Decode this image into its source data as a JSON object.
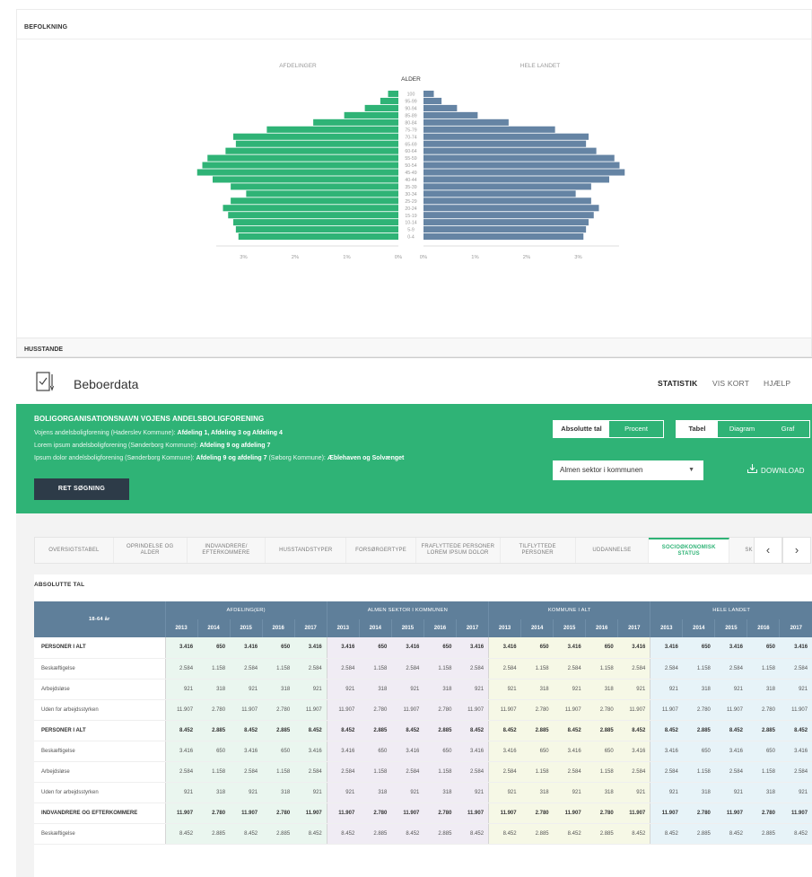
{
  "population": {
    "title": "BEFOLKNING",
    "left_label": "AFDELINGER",
    "right_label": "HELE LANDET",
    "center_label": "ALDER",
    "x_ticks_left": [
      "3%",
      "2%",
      "1%",
      "0%"
    ],
    "x_ticks_right": [
      "0%",
      "1%",
      "2%",
      "3%"
    ],
    "left_color": "#2fb376",
    "right_color": "#6584a4"
  },
  "chart_data": {
    "type": "bar",
    "orientation": "horizontal-pyramid",
    "categories": [
      "100",
      "95-99",
      "90-94",
      "85-89",
      "80-84",
      "75-79",
      "70-74",
      "65-69",
      "60-64",
      "55-59",
      "50-54",
      "45-49",
      "40-44",
      "35-39",
      "30-34",
      "25-29",
      "20-24",
      "15-19",
      "10-14",
      "5-9",
      "0-4"
    ],
    "series": [
      {
        "name": "AFDELINGER",
        "values": [
          0.2,
          0.35,
          0.65,
          1.05,
          1.65,
          2.55,
          3.2,
          3.15,
          3.35,
          3.7,
          3.8,
          3.9,
          3.6,
          3.25,
          2.95,
          3.25,
          3.4,
          3.3,
          3.2,
          3.15,
          3.1
        ]
      },
      {
        "name": "HELE LANDET",
        "values": [
          0.2,
          0.35,
          0.65,
          1.05,
          1.65,
          2.55,
          3.2,
          3.15,
          3.35,
          3.7,
          3.8,
          3.9,
          3.6,
          3.25,
          2.95,
          3.25,
          3.4,
          3.3,
          3.2,
          3.15,
          3.1
        ]
      }
    ],
    "xlim": [
      0,
      4
    ],
    "xlabel": "",
    "ylabel": "ALDER"
  },
  "husstande": {
    "title": "HUSSTANDE"
  },
  "app": {
    "title": "Beboerdata",
    "nav": [
      "STATISTIK",
      "VIS KORT",
      "HJÆLP"
    ]
  },
  "search": {
    "org_name": "BOLIGORGANISATIONSNAVN VOJENS ANDELSBOLIGFORENING",
    "line1_plain": "Vojens andelsboligforening  (Haderslev Kommune): ",
    "line1_bold": "Afdeling 1,  Afdeling 3 og Afdeling 4",
    "line2_plain": "Lorem ipsum andelsboligforening (Sønderborg Kommune): ",
    "line2_bold": "Afdeling 9 og afdeling 7",
    "line3_plain": "Ipsum dolor andelsboligforening (Sønderborg Kommune): ",
    "line3_bold": "Afdeling 9 og afdeling 7",
    "line3_plain2": " (Søborg Kommune): ",
    "line3_bold2": "Æblehaven og  Solvænget",
    "ret_button": "RET SØGNING",
    "toggle_values": [
      "Absolutte tal",
      "Procent"
    ],
    "toggle_view": [
      "Tabel",
      "Diagram",
      "Graf"
    ],
    "sector_select": "Almen sektor i kommunen",
    "download": "DOWNLOAD"
  },
  "tabs": [
    "OVERSIGTSTABEL",
    "OPRINDELSE OG ALDER",
    "INDVANDRERE/ EFTERKOMMERE",
    "HUSSTANDSTYPER",
    "FORSØRGERTYPE",
    "FRAFLYTTEDE PERSONER LOREM IPSUM DOLOR",
    "TILFLYTTEDE PERSONER",
    "UDDANNELSE",
    "SOCIOØKONOMISK STATUS",
    "SK"
  ],
  "table": {
    "section_title": "ABSOLUTTE TAL",
    "age_header": "18-64 år",
    "groups": [
      "AFDELING(ER)",
      "ALMEN SEKTOR I KOMMUNEN",
      "KOMMUNE I ALT",
      "HELE LANDET"
    ],
    "years": [
      "2013",
      "2014",
      "2015",
      "2016",
      "2017"
    ],
    "rows": [
      {
        "label": "PERSONER I ALT",
        "bold": true,
        "values": [
          "3.416",
          "650",
          "3.416",
          "650",
          "3.416"
        ]
      },
      {
        "label": "Beskæftigelse",
        "bold": false,
        "values": [
          "2.584",
          "1.158",
          "2.584",
          "1.158",
          "2.584"
        ]
      },
      {
        "label": "Arbejdsløse",
        "bold": false,
        "values": [
          "921",
          "318",
          "921",
          "318",
          "921"
        ]
      },
      {
        "label": "Uden for arbejdsstyrken",
        "bold": false,
        "values": [
          "11.907",
          "2.780",
          "11.907",
          "2.780",
          "11.907"
        ]
      },
      {
        "label": "PERSONER I ALT",
        "bold": true,
        "values": [
          "8.452",
          "2.885",
          "8.452",
          "2.885",
          "8.452"
        ]
      },
      {
        "label": "Beskæftigelse",
        "bold": false,
        "values": [
          "3.416",
          "650",
          "3.416",
          "650",
          "3.416"
        ]
      },
      {
        "label": "Arbejdsløse",
        "bold": false,
        "values": [
          "2.584",
          "1.158",
          "2.584",
          "1.158",
          "2.584"
        ]
      },
      {
        "label": "Uden for arbejdsstyrken",
        "bold": false,
        "values": [
          "921",
          "318",
          "921",
          "318",
          "921"
        ]
      },
      {
        "label": "INDVANDRERE OG EFTERKOMMERE",
        "bold": true,
        "values": [
          "11.907",
          "2.780",
          "11.907",
          "2.780",
          "11.907"
        ]
      },
      {
        "label": "Beskæftigelse",
        "bold": false,
        "values": [
          "8.452",
          "2.885",
          "8.452",
          "2.885",
          "8.452"
        ]
      }
    ]
  }
}
